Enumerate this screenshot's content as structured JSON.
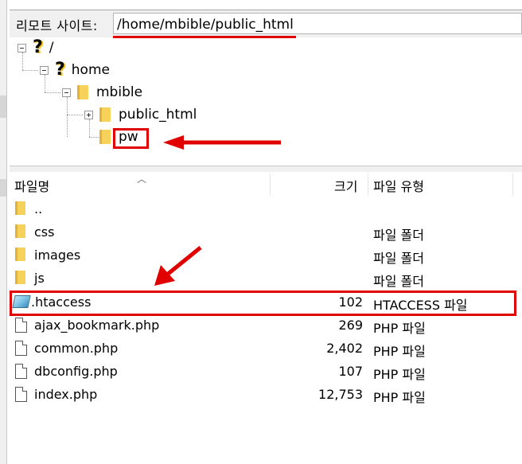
{
  "remote_site": {
    "label": "리모트 사이트:",
    "path": "/home/mbible/public_html"
  },
  "tree": [
    {
      "label": "/",
      "icon": "question-icon"
    },
    {
      "label": "home",
      "icon": "question-icon"
    },
    {
      "label": "mbible",
      "icon": "folder-icon"
    },
    {
      "label": "public_html",
      "icon": "folder-icon"
    },
    {
      "label": "pw",
      "icon": "folder-icon"
    }
  ],
  "list_header": {
    "name": "파일명",
    "size": "크기",
    "type": "파일 유형"
  },
  "files": [
    {
      "name": "..",
      "size": "",
      "type": "",
      "icon": "folder-icon"
    },
    {
      "name": "css",
      "size": "",
      "type": "파일 폴더",
      "icon": "folder-icon"
    },
    {
      "name": "images",
      "size": "",
      "type": "파일 폴더",
      "icon": "folder-icon"
    },
    {
      "name": "js",
      "size": "",
      "type": "파일 폴더",
      "icon": "folder-icon"
    },
    {
      "name": ".htaccess",
      "size": "102",
      "type": "HTACCESS 파일",
      "icon": "htaccess-file-icon"
    },
    {
      "name": "ajax_bookmark.php",
      "size": "269",
      "type": "PHP 파일",
      "icon": "file-icon"
    },
    {
      "name": "common.php",
      "size": "2,402",
      "type": "PHP 파일",
      "icon": "file-icon"
    },
    {
      "name": "dbconfig.php",
      "size": "107",
      "type": "PHP 파일",
      "icon": "file-icon"
    },
    {
      "name": "index.php",
      "size": "12,753",
      "type": "PHP 파일",
      "icon": "file-icon"
    }
  ],
  "colors": {
    "highlight_red": "#e00000",
    "folder_yellow": "#f7d25a"
  }
}
